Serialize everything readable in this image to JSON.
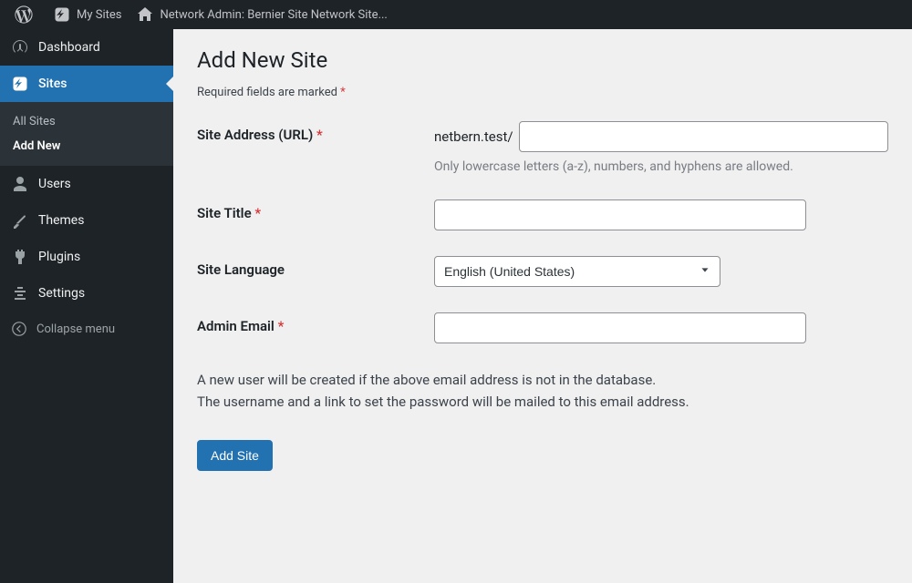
{
  "adminBar": {
    "mySites": "My Sites",
    "networkAdmin": "Network Admin: Bernier Site Network Site..."
  },
  "sidebar": {
    "dashboard": "Dashboard",
    "sites": "Sites",
    "sitesSub": {
      "allSites": "All Sites",
      "addNew": "Add New"
    },
    "users": "Users",
    "themes": "Themes",
    "plugins": "Plugins",
    "settings": "Settings",
    "collapse": "Collapse menu"
  },
  "page": {
    "title": "Add New Site",
    "requiredNote": "Required fields are marked ",
    "asterisk": "*"
  },
  "form": {
    "siteAddress": {
      "label": "Site Address (URL) ",
      "prefix": "netbern.test/",
      "help": "Only lowercase letters (a-z), numbers, and hyphens are allowed.",
      "value": ""
    },
    "siteTitle": {
      "label": "Site Title ",
      "value": ""
    },
    "siteLanguage": {
      "label": "Site Language",
      "selected": "English (United States)"
    },
    "adminEmail": {
      "label": "Admin Email ",
      "value": ""
    }
  },
  "notes": {
    "line1": "A new user will be created if the above email address is not in the database.",
    "line2": "The username and a link to set the password will be mailed to this email address."
  },
  "submit": {
    "label": "Add Site"
  }
}
